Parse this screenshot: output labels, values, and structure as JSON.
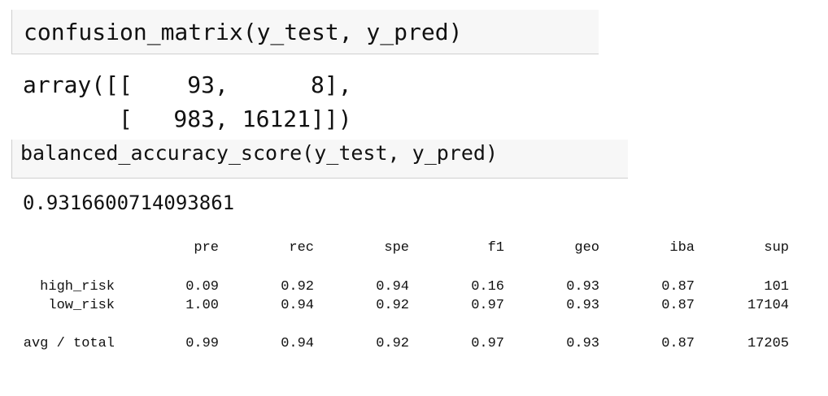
{
  "cells": [
    {
      "input": "confusion_matrix(y_test, y_pred)",
      "output_lines": [
        "array([[    93,      8],",
        "       [   983, 16121]])"
      ]
    },
    {
      "input": "balanced_accuracy_score(y_test, y_pred)",
      "output": "0.9316600714093861"
    }
  ],
  "report": {
    "headers": [
      "pre",
      "rec",
      "spe",
      "f1",
      "geo",
      "iba",
      "sup"
    ],
    "rows": [
      {
        "label": "high_risk",
        "values": [
          "0.09",
          "0.92",
          "0.94",
          "0.16",
          "0.93",
          "0.87",
          "101"
        ]
      },
      {
        "label": "low_risk",
        "values": [
          "1.00",
          "0.94",
          "0.92",
          "0.97",
          "0.93",
          "0.87",
          "17104"
        ]
      },
      {
        "label": "avg / total",
        "values": [
          "0.99",
          "0.94",
          "0.92",
          "0.97",
          "0.93",
          "0.87",
          "17205"
        ]
      }
    ]
  }
}
